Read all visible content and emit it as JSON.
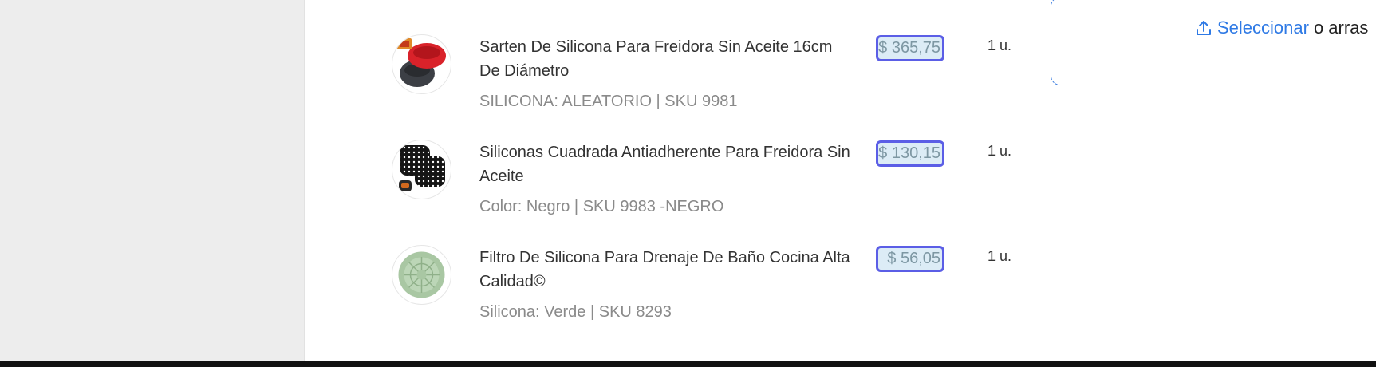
{
  "upload": {
    "link_label": "Seleccionar",
    "rest_text": "o arras"
  },
  "items": [
    {
      "title": "Sarten De Silicona Para Freidora Sin Aceite 16cm De Diámetro",
      "variant": "SILICONA: ALEATORIO | SKU 9981",
      "price": "$ 365,75",
      "qty": "1 u."
    },
    {
      "title": "Siliconas Cuadrada Antiadherente Para Freidora Sin Aceite",
      "variant": "Color: Negro | SKU 9983 -NEGRO",
      "price": "$ 130,15",
      "qty": "1 u."
    },
    {
      "title": "Filtro De Silicona Para Drenaje De Baño Cocina Alta Calidad©",
      "variant": "Silicona: Verde | SKU 8293",
      "price": "$ 56,05",
      "qty": "1 u."
    }
  ],
  "colors": {
    "link_blue": "#2f7ae5",
    "price_border": "#5b5ee6",
    "price_fill": "#dcecf6"
  },
  "icons": [
    "upload-icon",
    "product-thumbnail"
  ]
}
